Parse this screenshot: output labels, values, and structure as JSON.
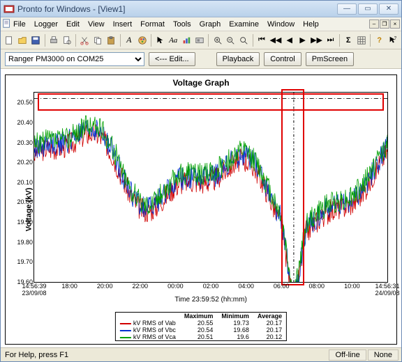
{
  "window": {
    "title": "Pronto for Windows - [View1]"
  },
  "menu": [
    "File",
    "Logger",
    "Edit",
    "View",
    "Insert",
    "Format",
    "Tools",
    "Graph",
    "Examine",
    "Window",
    "Help"
  ],
  "device_select": {
    "options": [
      "Ranger PM3000 on COM25"
    ],
    "selected": "Ranger PM3000 on COM25"
  },
  "buttons": {
    "edit": "<--- Edit...",
    "playback": "Playback",
    "control": "Control",
    "pmscreen": "PmScreen"
  },
  "status": {
    "help": "For Help, press F1",
    "conn": "Off-line",
    "mode": "None"
  },
  "chart_data": {
    "type": "line",
    "title": "Voltage Graph",
    "ylabel": "Voltage (kV)",
    "xlabel": "Time 23:59:52 (hh:mm)",
    "ylim": [
      19.6,
      20.55
    ],
    "yticks": [
      19.6,
      19.7,
      19.8,
      19.9,
      20.0,
      20.1,
      20.2,
      20.3,
      20.4,
      20.5
    ],
    "xticks": [
      "14:56:39",
      "18:00",
      "20:00",
      "22:00",
      "00:00",
      "02:00",
      "04:00",
      "06:00",
      "08:00",
      "10:00",
      "14:56:31"
    ],
    "x_left_sub": "23/09/08",
    "x_right_sub": "24/09/08",
    "series": [
      {
        "name": "kV RMS of Vab",
        "color": "#d00000",
        "max": 20.55,
        "min": 19.73,
        "avg": 20.17
      },
      {
        "name": "kV RMS of Vbc",
        "color": "#0030d0",
        "max": 20.54,
        "min": 19.68,
        "avg": 20.17
      },
      {
        "name": "kV RMS of Vca",
        "color": "#00a000",
        "max": 20.51,
        "min": 19.6,
        "avg": 20.12
      }
    ],
    "legend_headers": [
      "Maximum",
      "Minimum",
      "Average"
    ]
  }
}
